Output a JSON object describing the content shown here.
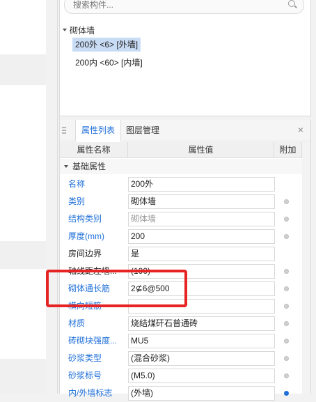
{
  "search": {
    "placeholder": "搜索构件..."
  },
  "tree": {
    "root": "砌体墙",
    "items": [
      {
        "label": "200外 <6> [外墙]",
        "selected": true
      },
      {
        "label": "200内 <60> [内墙]",
        "selected": false
      }
    ]
  },
  "tabs": {
    "properties": "属性列表",
    "layers": "图层管理"
  },
  "columns": {
    "name": "属性名称",
    "value": "属性值",
    "extra": "附加"
  },
  "group": {
    "basic": "基础属性"
  },
  "rows": [
    {
      "name": "名称",
      "value": "200外"
    },
    {
      "name": "类别",
      "value": "砌体墙"
    },
    {
      "name": "结构类别",
      "value": "砌体墙"
    },
    {
      "name": "厚度(mm)",
      "value": "200"
    },
    {
      "name": "房间边界",
      "value": "是"
    },
    {
      "name": "轴线距左墙...",
      "value": "(100)"
    },
    {
      "name": "砌体通长筋",
      "value": "2⊈6@500"
    },
    {
      "name": "横向短筋",
      "value": ""
    },
    {
      "name": "材质",
      "value": "烧结煤矸石普通砖"
    },
    {
      "name": "砖砌块强度...",
      "value": "MU5"
    },
    {
      "name": "砂浆类型",
      "value": "(混合砂浆)"
    },
    {
      "name": "砂浆标号",
      "value": "(M5.0)"
    },
    {
      "name": "内/外墙标志",
      "value": "(外墙)"
    }
  ],
  "colors": {
    "accent": "#1e6fd9",
    "selection": "#c9dcf5",
    "highlight_box": "#e62424"
  }
}
